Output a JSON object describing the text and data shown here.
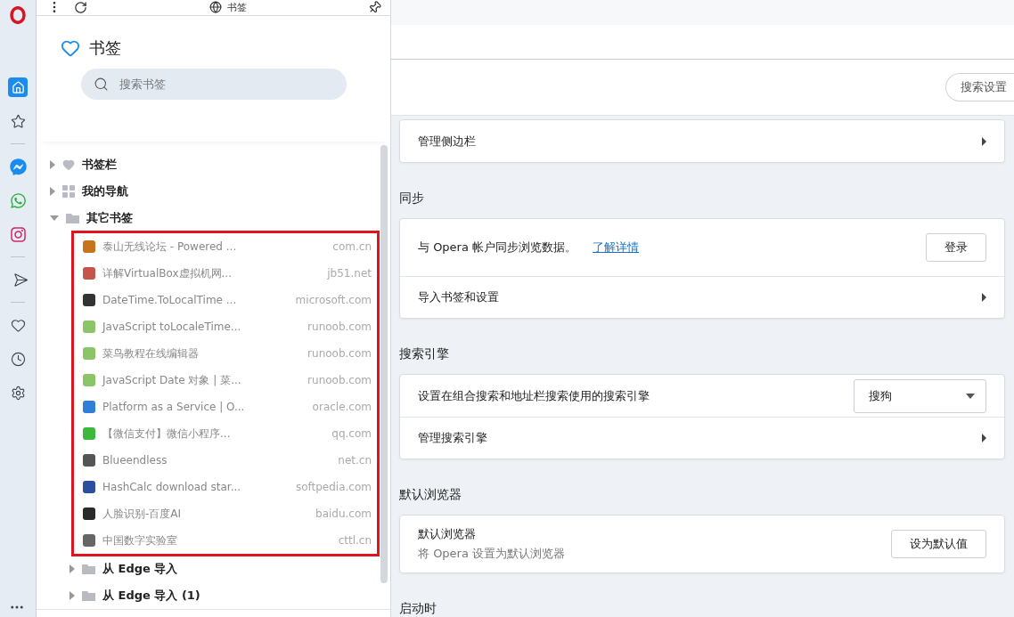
{
  "sidebar_items": [
    {
      "kind": "logo"
    },
    {
      "kind": "home",
      "selected": true
    },
    {
      "kind": "star",
      "selected": false
    },
    {
      "kind": "divider"
    },
    {
      "kind": "messenger",
      "selected": false
    },
    {
      "kind": "whatsapp",
      "selected": false
    },
    {
      "kind": "instagram",
      "selected": false
    },
    {
      "kind": "divider"
    },
    {
      "kind": "send",
      "selected": false
    },
    {
      "kind": "divider"
    },
    {
      "kind": "heart",
      "selected": false
    },
    {
      "kind": "clock",
      "selected": false
    },
    {
      "kind": "settings",
      "selected": false
    }
  ],
  "bookmarks_panel": {
    "toolbar_title": "书签",
    "heading": "书签",
    "search": {
      "placeholder": "搜索书签"
    },
    "tree": [
      {
        "label": "书签栏",
        "kind": "heart",
        "expanded": false
      },
      {
        "label": "我的导航",
        "kind": "grid",
        "expanded": false
      },
      {
        "label": "其它书签",
        "kind": "folder",
        "expanded": true,
        "highlighted": true,
        "children": [
          {
            "kind": "link",
            "title": "泰山无线论坛 - Powered ...",
            "domain": "com.cn",
            "color": "#c8741e"
          },
          {
            "kind": "link",
            "title": "详解VirtualBox虚拟机网...",
            "domain": "jb51.net",
            "color": "#c4554a"
          },
          {
            "kind": "link",
            "title": "DateTime.ToLocalTime ...",
            "domain": "microsoft.com",
            "color": "#333333"
          },
          {
            "kind": "link",
            "title": "JavaScript toLocaleTime...",
            "domain": "runoob.com",
            "color": "#8cc46a"
          },
          {
            "kind": "link",
            "title": "菜鸟教程在线编辑器",
            "domain": "runoob.com",
            "color": "#8cc46a"
          },
          {
            "kind": "link",
            "title": "JavaScript Date 对象 | 菜...",
            "domain": "runoob.com",
            "color": "#8cc46a"
          },
          {
            "kind": "link",
            "title": "Platform as a Service | O...",
            "domain": "oracle.com",
            "color": "#2f7fd6"
          },
          {
            "kind": "link",
            "title": "【微信支付】微信小程序...",
            "domain": "qq.com",
            "color": "#3cb83c"
          },
          {
            "kind": "link",
            "title": "Blueendless",
            "domain": "net.cn",
            "color": "#555555"
          },
          {
            "kind": "link",
            "title": "HashCalc download star...",
            "domain": "softpedia.com",
            "color": "#2a4ea0"
          },
          {
            "kind": "link",
            "title": "人脸识别-百度AI",
            "domain": "baidu.com",
            "color": "#2a2a2a"
          },
          {
            "kind": "link",
            "title": "中国数字实验室",
            "domain": "cttl.cn",
            "color": "#666666"
          },
          {
            "kind": "folder",
            "title": "从 Edge 导入",
            "expanded": false
          },
          {
            "kind": "folder",
            "title": "从 Edge 导入 (1)",
            "expanded": false
          }
        ]
      }
    ]
  },
  "settings": {
    "search_button": "搜索设置",
    "sections": [
      {
        "rows": [
          {
            "kind": "link",
            "label": "管理侧边栏"
          }
        ]
      },
      {
        "title": "同步",
        "rows": [
          {
            "kind": "action",
            "label": "与 Opera 帐户同步浏览数据。",
            "link": "了解详情",
            "button": "登录"
          },
          {
            "kind": "link",
            "label": "导入书签和设置"
          }
        ]
      },
      {
        "title": "搜索引擎",
        "rows": [
          {
            "kind": "select",
            "label": "设置在组合搜索和地址栏搜索使用的搜索引擎",
            "value": "搜狗"
          },
          {
            "kind": "link",
            "label": "管理搜索引擎"
          }
        ]
      },
      {
        "title": "默认浏览器",
        "rows": [
          {
            "kind": "action",
            "label": "默认浏览器",
            "sublabel": "将 Opera 设置为默认浏览器",
            "button": "设为默认值"
          }
        ]
      },
      {
        "title": "启动时"
      }
    ]
  }
}
